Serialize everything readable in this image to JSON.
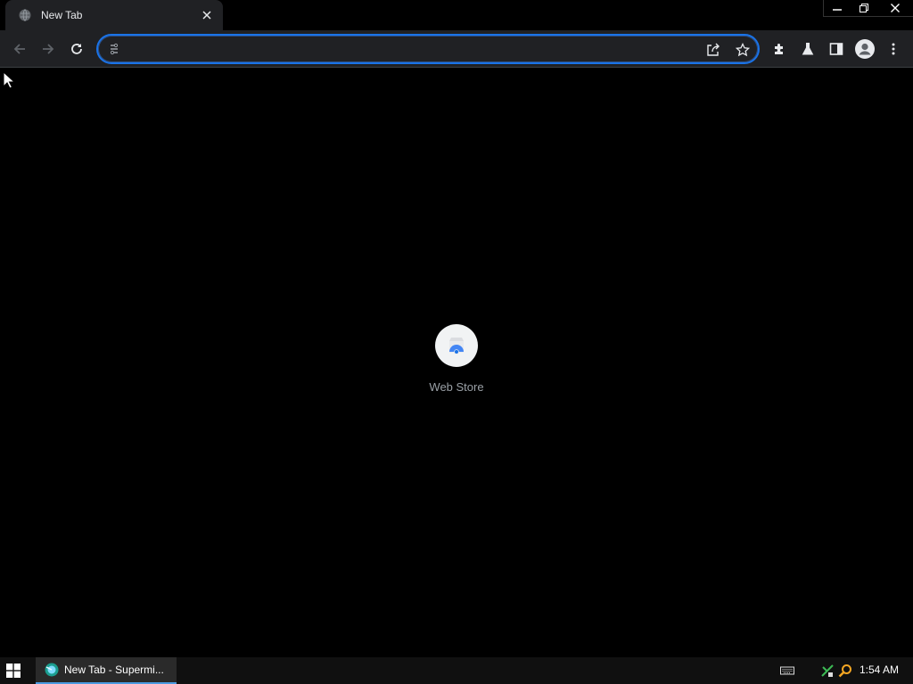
{
  "tab": {
    "title": "New Tab",
    "favicon": "globe-icon"
  },
  "window": {
    "controls": [
      "minimize-icon",
      "restore-icon",
      "close-icon"
    ]
  },
  "toolbar": {
    "buttons": [
      "back-arrow-icon",
      "forward-arrow-icon",
      "reload-icon"
    ],
    "omnibox": {
      "value": "",
      "placeholder": ""
    },
    "omnibox_icons": [
      "share-icon",
      "bookmark-star-icon"
    ],
    "right_icons": [
      "extensions-puzzle-icon",
      "labs-flask-icon",
      "side-panel-icon",
      "profile-avatar-icon",
      "menu-dots-icon"
    ]
  },
  "newtab": {
    "shortcuts": [
      {
        "label": "Web Store",
        "icon": "web-store-icon"
      }
    ]
  },
  "taskbar": {
    "app_label": "New Tab - Supermi...",
    "clock": "1:54 AM",
    "tray_icons": [
      "keyboard-icon",
      "network-icon",
      "search-magnifier-icon"
    ]
  },
  "colors": {
    "accent": "#1a73e8",
    "toolbar_bg": "#202124",
    "page_bg": "#000000",
    "taskbar_bg": "#101010"
  }
}
